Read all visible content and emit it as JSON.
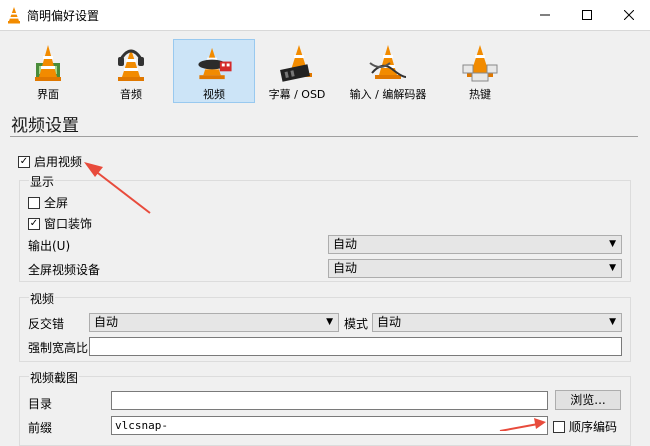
{
  "window": {
    "title": "简明偏好设置",
    "controls": {
      "minimize": "—",
      "maximize": "☐",
      "close": "✕"
    }
  },
  "toolbar": {
    "items": [
      {
        "label": "界面",
        "icon": "interface-cone-icon",
        "active": false
      },
      {
        "label": "音频",
        "icon": "audio-headphones-cone-icon",
        "active": false
      },
      {
        "label": "视频",
        "icon": "video-cone-icon",
        "active": true
      },
      {
        "label": "字幕 / OSD",
        "icon": "subtitle-cone-icon",
        "active": false
      },
      {
        "label": "输入 / 编解码器",
        "icon": "input-codec-cone-icon",
        "active": false
      },
      {
        "label": "热键",
        "icon": "hotkeys-cone-icon",
        "active": false
      }
    ]
  },
  "page": {
    "heading": "视频设置",
    "enable_video": {
      "label": "启用视频",
      "checked": true
    }
  },
  "display": {
    "title": "显示",
    "fullscreen": {
      "label": "全屏",
      "checked": false
    },
    "window_decorations": {
      "label": "窗口装饰",
      "checked": true
    },
    "output_label": "输出(U)",
    "output_value": "自动",
    "fullscreen_device_label": "全屏视频设备",
    "fullscreen_device_value": "自动"
  },
  "video": {
    "title": "视频",
    "deinterlace_label": "反交错",
    "deinterlace_value": "自动",
    "mode_label": "模式",
    "mode_value": "自动",
    "aspect_label": "强制宽高比",
    "aspect_value": ""
  },
  "snapshot": {
    "title": "视频截图",
    "dir_label": "目录",
    "dir_value": "",
    "browse_label": "浏览...",
    "prefix_label": "前缀",
    "prefix_value": "vlcsnap-",
    "sequential": {
      "label": "顺序编码",
      "checked": false
    }
  },
  "colors": {
    "accent": "#e84b3c",
    "active_tab_bg": "#cce4f7",
    "vlc_orange": "#f28b00"
  }
}
